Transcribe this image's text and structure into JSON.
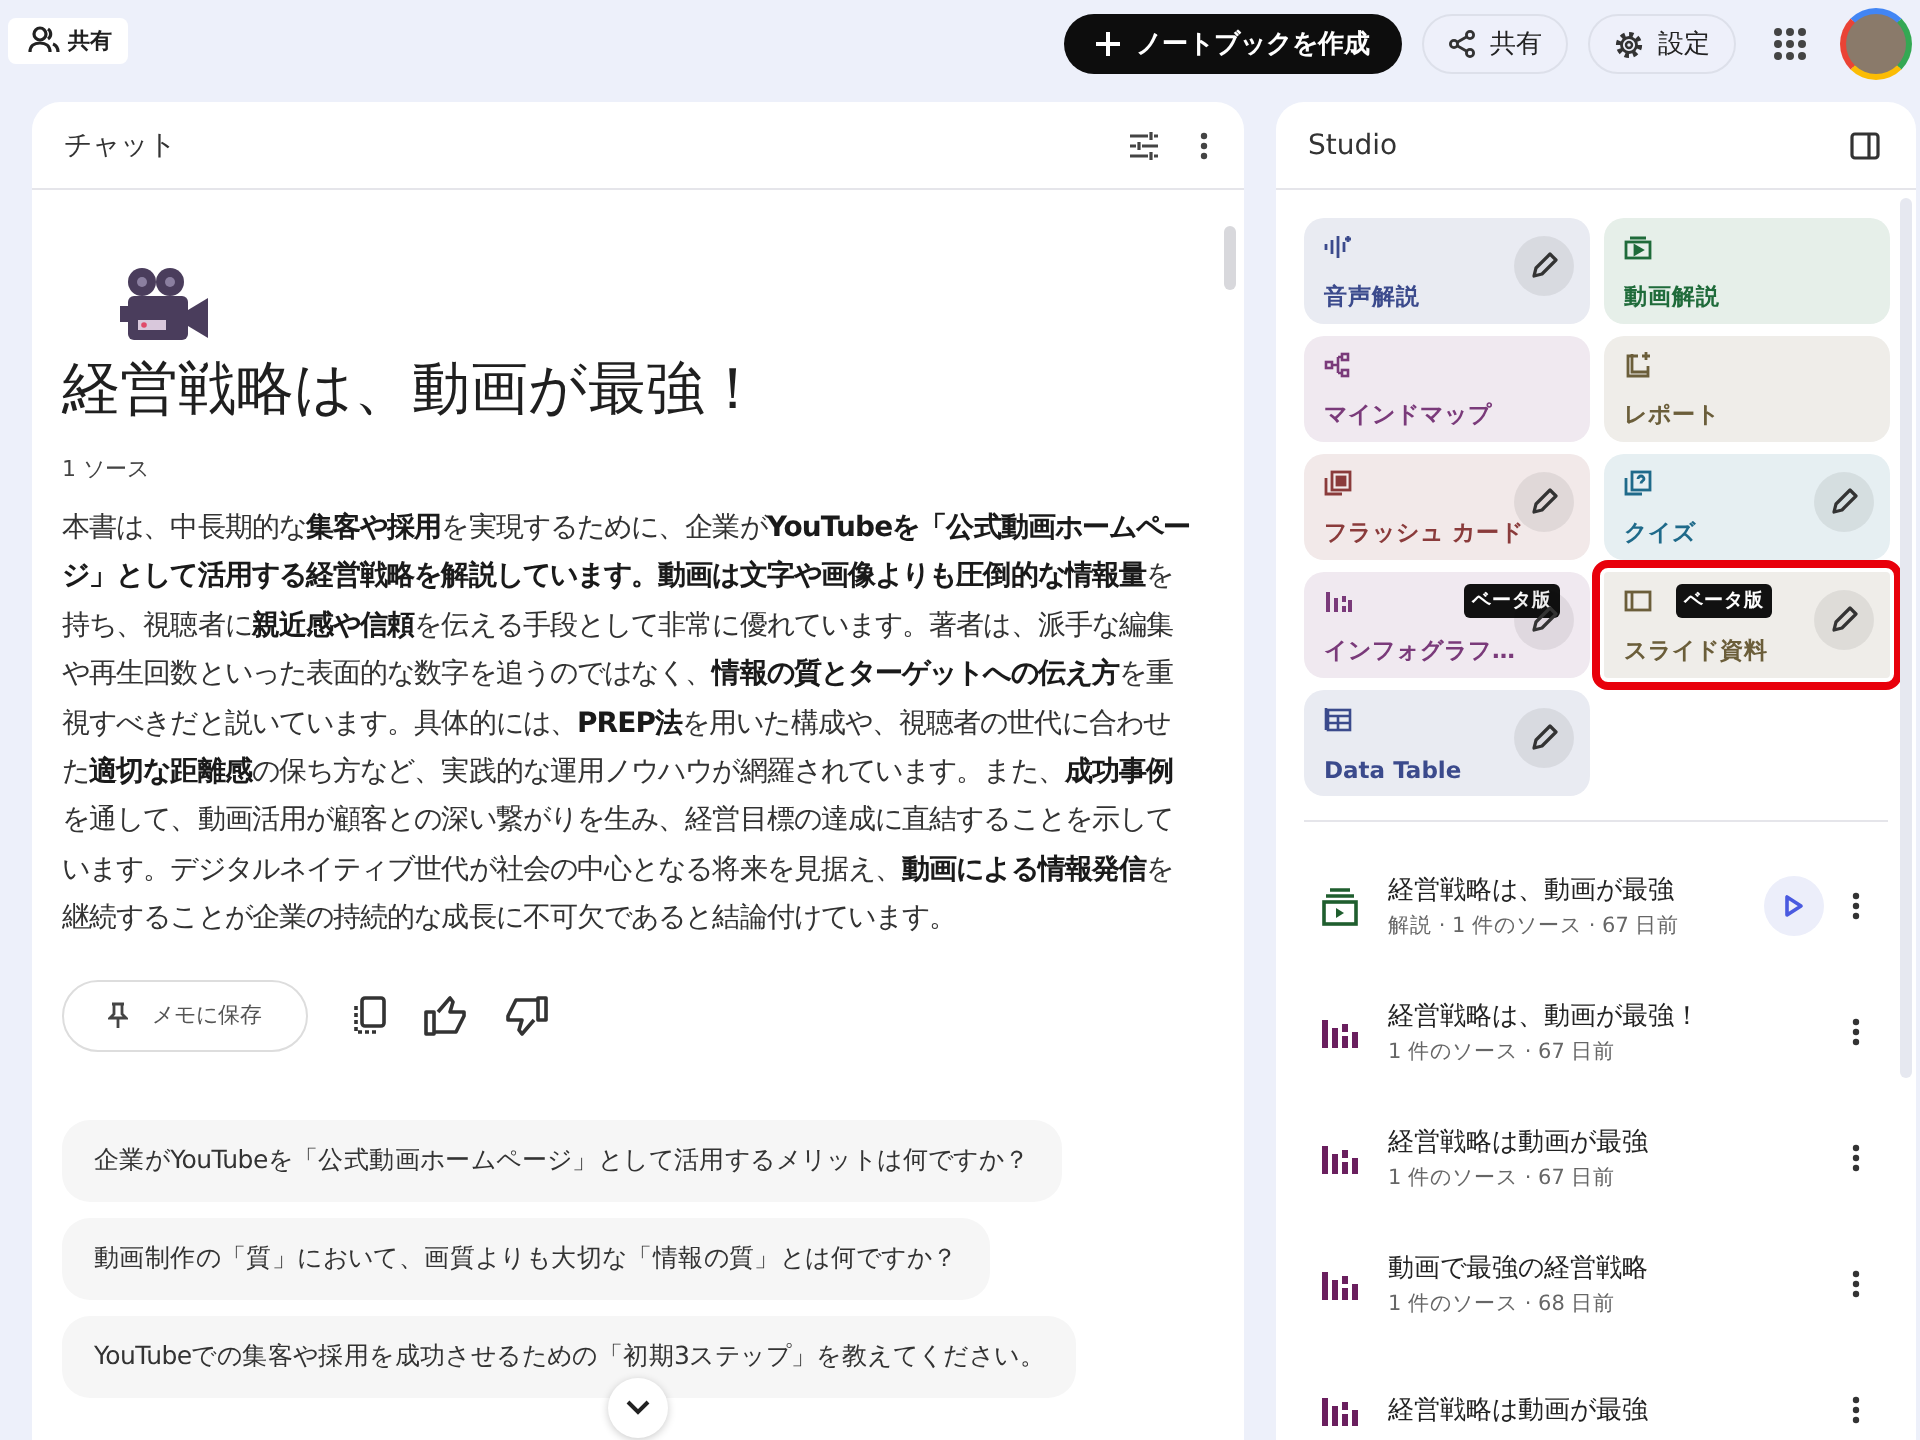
{
  "topbar": {
    "share_label": "共有",
    "create_button": "ノートブックを作成",
    "share_button": "共有",
    "settings_button": "設定"
  },
  "chat": {
    "title": "チャット",
    "heading": "経営戦略は、動画が最強！",
    "source_count": "1 ソース",
    "summary": "本書は、中長期的な**集客や採用**を実現するために、企業が**YouTubeを「公式動画ホームページ」として活用する経営戦略を解説しています。動画は文字や画像よりも圧倒的な情報量**を持ち、視聴者に**親近感や信頼**を伝える手段として非常に優れています。著者は、派手な編集や再生回数といった表面的な数字を追うのではなく、**情報の質とターゲットへの伝え方**を重視すべきだと説いています。具体的には、**PREP法**を用いた構成や、視聴者の世代に合わせた**適切な距離感**の保ち方など、実践的な運用ノウハウが網羅されています。また、**成功事例**を通して、動画活用が顧客との深い繋がりを生み、経営目標の達成に直結することを示しています。デジタルネイティブ世代が社会の中心となる将来を見据え、**動画による情報発信**を継続することが企業の持続的な成長に不可欠であると結論付けています。",
    "save_note_button": "メモに保存",
    "suggestions": [
      "企業がYouTubeを「公式動画ホームページ」として活用するメリットは何ですか？",
      "動画制作の「質」において、画質よりも大切な「情報の質」とは何ですか？",
      "YouTubeでの集客や採用を成功させるための「初期3ステップ」を教えてください。"
    ]
  },
  "studio": {
    "title": "Studio",
    "tiles": [
      {
        "label": "音声解説",
        "kind": "audio",
        "color": "#3b4a8c",
        "edit": true,
        "selected": false
      },
      {
        "label": "動画解説",
        "kind": "video",
        "color": "#1f6b3a",
        "edit": false,
        "selected": false
      },
      {
        "label": "マインドマップ",
        "kind": "mindmap",
        "color": "#7a3a7a",
        "edit": false,
        "selected": false
      },
      {
        "label": "レポート",
        "kind": "report",
        "color": "#6b5e3a",
        "edit": false,
        "selected": false
      },
      {
        "label": "フラッシュ カード",
        "kind": "flashcard",
        "color": "#8a3b3b",
        "edit": true,
        "selected": false
      },
      {
        "label": "クイズ",
        "kind": "quiz",
        "color": "#1f6a8a",
        "edit": true,
        "selected": false
      },
      {
        "label": "インフォグラフ…",
        "kind": "infographic",
        "color": "#7a3a7a",
        "edit": true,
        "badge": "ベータ版",
        "selected": false
      },
      {
        "label": "スライド資料",
        "kind": "slides",
        "color": "#6b5e3a",
        "edit": true,
        "badge": "ベータ版",
        "selected": true
      },
      {
        "label": "Data Table",
        "kind": "table",
        "color": "#3b4a8c",
        "edit": true,
        "selected": false
      }
    ],
    "outputs": [
      {
        "title": "経営戦略は、動画が最強",
        "meta": "解説 · 1 件のソース · 67 日前",
        "kind": "video",
        "play": true
      },
      {
        "title": "経営戦略は、動画が最強！",
        "meta": "1 件のソース · 67 日前",
        "kind": "infographic",
        "play": false
      },
      {
        "title": "経営戦略は動画が最強",
        "meta": "1 件のソース · 67 日前",
        "kind": "infographic",
        "play": false
      },
      {
        "title": "動画で最強の経営戦略",
        "meta": "1 件のソース · 68 日前",
        "kind": "infographic",
        "play": false
      },
      {
        "title": "経営戦略は動画が最強",
        "kind": "infographic",
        "play": false
      }
    ]
  }
}
